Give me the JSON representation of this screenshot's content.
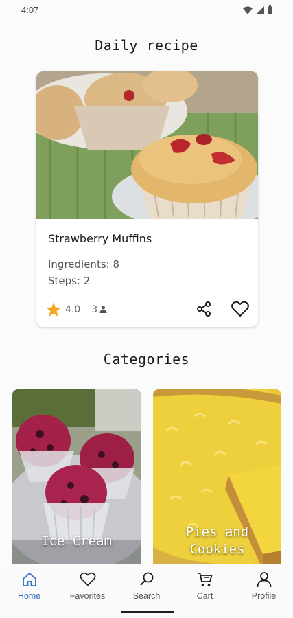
{
  "status_bar": {
    "time": "4:07"
  },
  "daily": {
    "title": "Daily recipe",
    "recipe": {
      "name": "Strawberry Muffins",
      "ingredients": "Ingredients: 8",
      "steps": "Steps: 2",
      "rating": "4.0",
      "count": "3",
      "image": "muffin-photo"
    }
  },
  "categories": {
    "title": "Categories",
    "items": [
      {
        "label": "Ice Cream",
        "image": "ice-cream-photo"
      },
      {
        "label": "Pies and\nCookies",
        "image": "lemon-tart-photo"
      }
    ]
  },
  "nav": {
    "items": [
      {
        "label": "Home",
        "icon": "home-icon",
        "active": true
      },
      {
        "label": "Favorites",
        "icon": "heart-icon"
      },
      {
        "label": "Search",
        "icon": "search-icon"
      },
      {
        "label": "Cart",
        "icon": "cart-icon"
      },
      {
        "label": "Profile",
        "icon": "person-icon"
      }
    ]
  },
  "colors": {
    "star": "#f5a623",
    "accent": "#2f6fbf"
  }
}
